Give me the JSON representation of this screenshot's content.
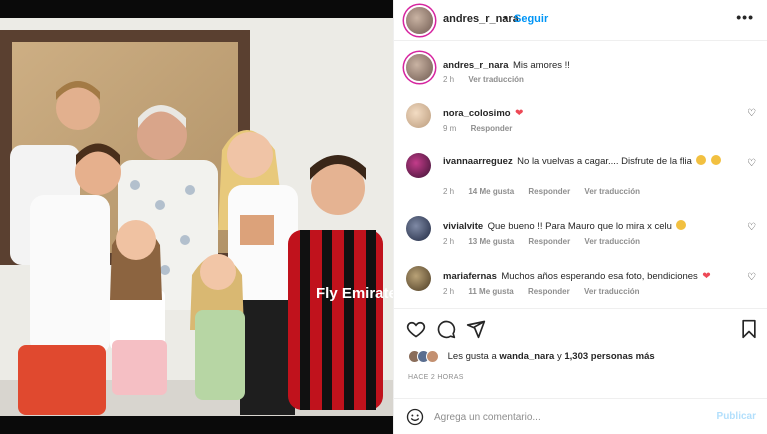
{
  "post": {
    "username": "andres_r_nara",
    "follow_label": "Seguir",
    "more_icon": "more-options-icon",
    "caption": {
      "username": "andres_r_nara",
      "text": "Mis amores !!",
      "time": "2 h",
      "translate": "Ver traducción"
    }
  },
  "comments": [
    {
      "username": "nora_colosimo",
      "text": "",
      "emoji": "heart",
      "time": "9 m",
      "likes": "",
      "reply": "Responder",
      "translate": ""
    },
    {
      "username": "ivannaarreguez",
      "text": "No la vuelvas a cagar.... Disfrute de la flia",
      "emoji": "face",
      "time": "2 h",
      "likes": "14 Me gusta",
      "reply": "Responder",
      "translate": "Ver traducción"
    },
    {
      "username": "vivialvite",
      "text": "Que bueno !! Para Mauro que lo mira x celu",
      "emoji": "face",
      "time": "2 h",
      "likes": "13 Me gusta",
      "reply": "Responder",
      "translate": "Ver traducción"
    },
    {
      "username": "mariafernas",
      "text": "Muchos años esperando esa foto, bendiciones",
      "emoji": "heart",
      "time": "2 h",
      "likes": "11 Me gusta",
      "reply": "Responder",
      "translate": "Ver traducción"
    }
  ],
  "likes": {
    "prefix": "Les gusta a",
    "user": "wanda_nara",
    "middle": "y",
    "count": "1,303 personas más"
  },
  "time_ago": "HACE 2 HORAS",
  "add_comment": {
    "placeholder": "Agrega un comentario...",
    "publish_label": "Publicar"
  },
  "colors": {
    "link_blue": "#0095f6",
    "heart_red": "#ed4956",
    "muted": "#8e8e8e",
    "publish_disabled": "#b2dffc"
  },
  "photo": {
    "jersey_text": "Fly Emirates"
  }
}
